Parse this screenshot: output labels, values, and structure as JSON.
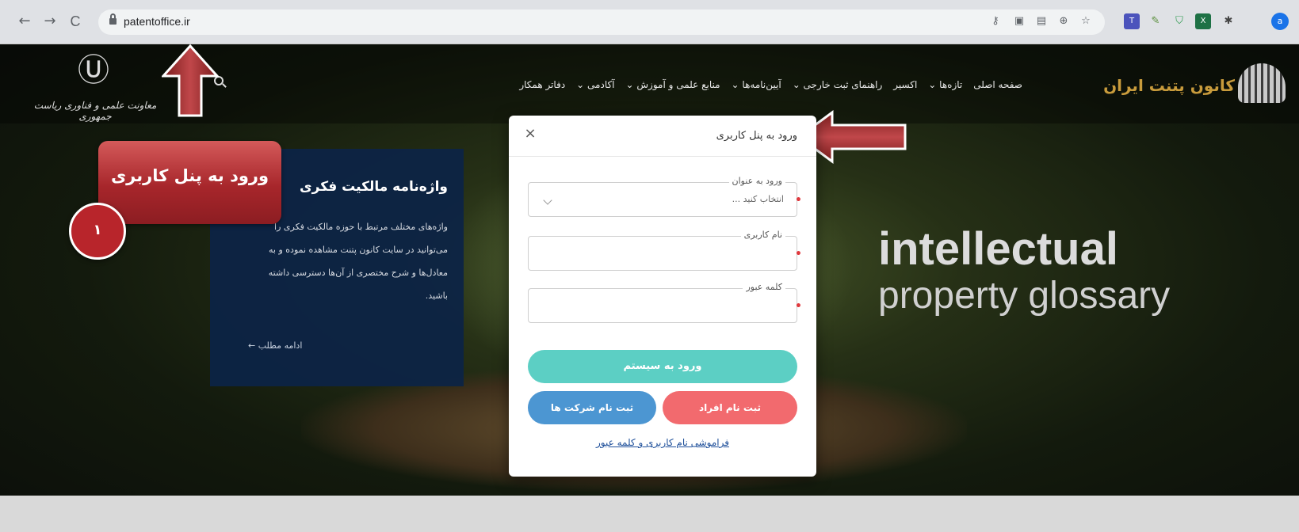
{
  "browser": {
    "url": "patentoffice.ir",
    "back": "←",
    "forward": "→",
    "reload": "C",
    "profile_initial": "a",
    "extensions": [
      "key-icon",
      "screen-icon",
      "translate-icon",
      "zoom-icon",
      "star-icon",
      "teams-ext-icon",
      "pen-ext-icon",
      "shield-ext-icon",
      "excel-ext-icon",
      "puzzle-icon"
    ]
  },
  "header": {
    "brand_name": "کانون پتنت ایران",
    "menu": [
      "صفحه اصلی",
      "تازه‌ها ⌄",
      "اکسیر",
      "راهنمای ثبت خارجی ⌄",
      "آیین‌نامه‌ها ⌄",
      "منابع علمی و آموزش ⌄",
      "آکادمی ⌄",
      "دفاتر همکار"
    ],
    "emblem_caption": "معاونت علمی و فناوری ریاست جمهوری",
    "emblem_glyph": "Ⓤ"
  },
  "hero": {
    "line1": "intellectual",
    "line2": "property glossary"
  },
  "info_box": {
    "title": "واژه‌نامه مالکیت فکری",
    "body": "واژه‌های مختلف مرتبط با حوزه مالکیت فکری را می‌توانید در سایت کانون پتنت مشاهده نموده و به معادل‌ها و شرح مختصری از آن‌ها دسترسی داشته باشید.",
    "more": "ادامه مطلب ←"
  },
  "callout": {
    "text": "ورود به پنل کاربری",
    "badge": "۱"
  },
  "modal": {
    "title": "ورود به پنل کاربری",
    "close": "×",
    "role_label": "ورود به عنوان",
    "role_value": "انتخاب کنید ...",
    "username_label": "نام کاربری",
    "password_label": "کلمه عبور",
    "required_mark": "•",
    "login": "ورود به سیستم",
    "register_person": "ثبت نام افراد",
    "register_company": "ثبت نام شرکت ها",
    "forgot": "فراموشی نام کاربری و کلمه عبور"
  },
  "colors": {
    "login_button": "#5ccfc4",
    "register_person_button": "#f26a6e",
    "register_company_button": "#4c96d2",
    "callout": "#a7262b",
    "brand": "#c89b3c",
    "info_box": "#0c2346"
  }
}
